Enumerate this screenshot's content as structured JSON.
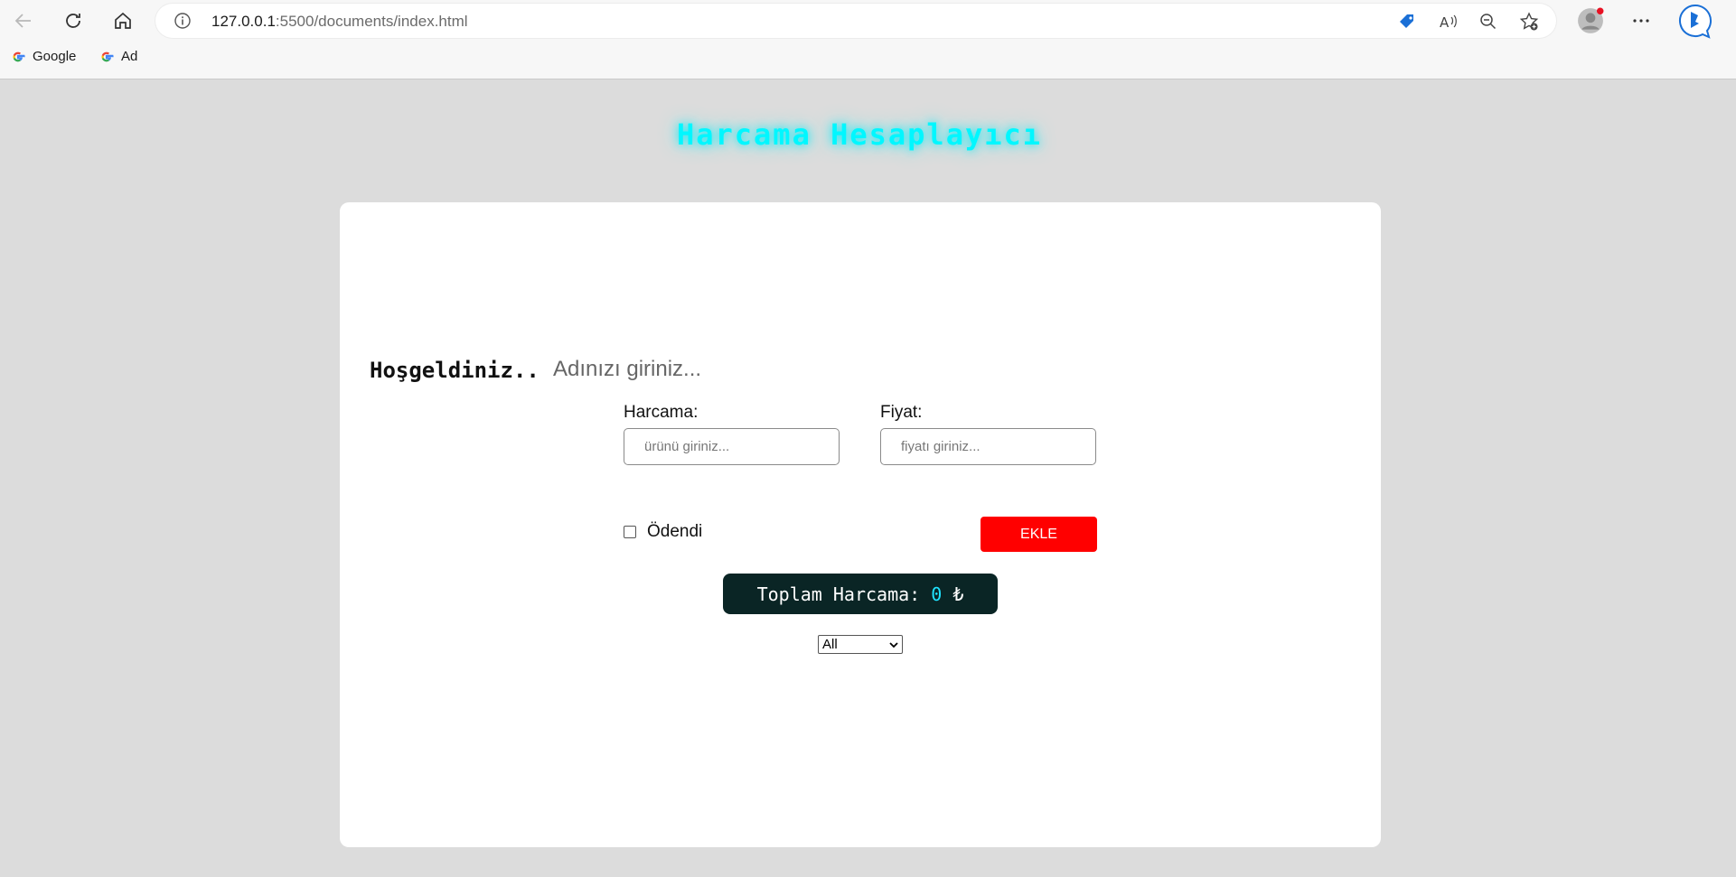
{
  "browser": {
    "url_host": "127.0.0.1",
    "url_path": ":5500/documents/index.html",
    "bookmarks": [
      {
        "label": "Google"
      },
      {
        "label": "Ad"
      }
    ]
  },
  "app": {
    "title": "Harcama Hesaplayıcı",
    "welcome": "Hoşgeldiniz..",
    "name_placeholder": "Adınızı giriniz...",
    "expense_label": "Harcama:",
    "expense_placeholder": "ürünü giriniz...",
    "price_label": "Fiyat:",
    "price_placeholder": "fiyatı giriniz...",
    "paid_label": "Ödendi",
    "add_button": "EKLE",
    "total_label": "Toplam Harcama: ",
    "total_amount": "0",
    "currency": " ₺",
    "filter_selected": "All"
  },
  "colors": {
    "title": "#00f7ff",
    "add_button": "#ff0000",
    "total_bg": "#0a2525",
    "total_amount": "#1fe3ff"
  }
}
